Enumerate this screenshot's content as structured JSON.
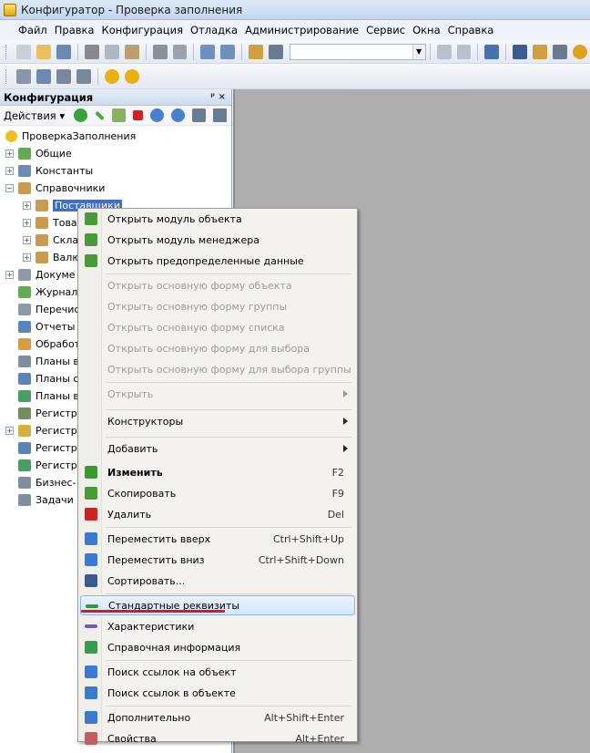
{
  "window": {
    "title": "Конфигуратор - Проверка заполнения"
  },
  "menubar": [
    "Файл",
    "Правка",
    "Конфигурация",
    "Отладка",
    "Администрирование",
    "Сервис",
    "Окна",
    "Справка"
  ],
  "panel": {
    "title": "Конфигурация",
    "actions_label": "Действия",
    "pin": "ᵖ ×",
    "tree": [
      {
        "label": "ПроверкаЗаполнения",
        "level": 0,
        "expander": "",
        "icon": "config-root-icon",
        "color": "#f0c020"
      },
      {
        "label": "Общие",
        "level": 1,
        "expander": "+",
        "icon": "common-icon",
        "color": "#4a9a3a"
      },
      {
        "label": "Константы",
        "level": 1,
        "expander": "+",
        "icon": "constants-icon",
        "color": "#5577aa"
      },
      {
        "label": "Справочники",
        "level": 1,
        "expander": "−",
        "icon": "catalogs-icon",
        "color": "#c08a30"
      },
      {
        "label": "Поставщики",
        "level": 2,
        "expander": "+",
        "icon": "catalog-icon",
        "color": "#c08a30",
        "selected": true
      },
      {
        "label": "Това",
        "level": 2,
        "expander": "+",
        "icon": "catalog-icon",
        "color": "#c08a30"
      },
      {
        "label": "Скла",
        "level": 2,
        "expander": "+",
        "icon": "catalog-icon",
        "color": "#c08a30"
      },
      {
        "label": "Валю",
        "level": 2,
        "expander": "+",
        "icon": "catalog-icon",
        "color": "#c08a30"
      },
      {
        "label": "Докуме",
        "level": 1,
        "expander": "+",
        "icon": "documents-icon",
        "color": "#7a8899"
      },
      {
        "label": "Журнал",
        "level": 1,
        "expander": "",
        "icon": "journals-icon",
        "color": "#4a9a3a"
      },
      {
        "label": "Перечис",
        "level": 1,
        "expander": "",
        "icon": "enums-icon",
        "color": "#7a8899"
      },
      {
        "label": "Отчеты",
        "level": 1,
        "expander": "",
        "icon": "reports-icon",
        "color": "#3a6fb0"
      },
      {
        "label": "Обработ",
        "level": 1,
        "expander": "",
        "icon": "dataprocessors-icon",
        "color": "#d08a20"
      },
      {
        "label": "Планы в",
        "level": 1,
        "expander": "",
        "icon": "chart-of-characteristics-icon",
        "color": "#6a7a90"
      },
      {
        "label": "Планы с",
        "level": 1,
        "expander": "",
        "icon": "chart-of-accounts-icon",
        "color": "#3a6fb0"
      },
      {
        "label": "Планы в",
        "level": 1,
        "expander": "",
        "icon": "chart-of-calc-icon",
        "color": "#2e8a4a"
      },
      {
        "label": "Регистр",
        "level": 1,
        "expander": "",
        "icon": "info-registers-icon",
        "color": "#5a7a40"
      },
      {
        "label": "Регистр",
        "level": 1,
        "expander": "+",
        "icon": "accum-registers-icon",
        "color": "#d0a020"
      },
      {
        "label": "Регистр",
        "level": 1,
        "expander": "",
        "icon": "accounting-registers-icon",
        "color": "#3a6fb0"
      },
      {
        "label": "Регистр",
        "level": 1,
        "expander": "",
        "icon": "calc-registers-icon",
        "color": "#2e8a4a"
      },
      {
        "label": "Бизнес-",
        "level": 1,
        "expander": "",
        "icon": "business-processes-icon",
        "color": "#6a7a90"
      },
      {
        "label": "Задачи",
        "level": 1,
        "expander": "",
        "icon": "tasks-icon",
        "color": "#6a7a90"
      }
    ]
  },
  "context_menu": [
    {
      "label": "Открыть модуль объекта",
      "icon": "module-object-icon",
      "color": "#4a9a3a"
    },
    {
      "label": "Открыть модуль менеджера",
      "icon": "module-manager-icon",
      "color": "#4a9a3a"
    },
    {
      "label": "Открыть предопределенные данные",
      "icon": "predefined-data-icon",
      "color": "#4a9a3a"
    },
    {
      "sep": true
    },
    {
      "label": "Открыть основную форму объекта",
      "disabled": true
    },
    {
      "label": "Открыть основную форму группы",
      "disabled": true
    },
    {
      "label": "Открыть основную форму списка",
      "disabled": true
    },
    {
      "label": "Открыть основную форму для выбора",
      "disabled": true
    },
    {
      "label": "Открыть основную форму для выбора группы",
      "disabled": true
    },
    {
      "sep": true
    },
    {
      "label": "Открыть",
      "disabled": true,
      "submenu": true
    },
    {
      "sep": true
    },
    {
      "label": "Конструкторы",
      "submenu": true
    },
    {
      "sep": true
    },
    {
      "label": "Добавить",
      "submenu": true
    },
    {
      "label": "Изменить",
      "bold": true,
      "shortcut": "F2",
      "icon": "edit-pencil-icon",
      "color": "#3a9a30"
    },
    {
      "label": "Скопировать",
      "shortcut": "F9",
      "icon": "copy-icon",
      "color": "#4a9a3a"
    },
    {
      "label": "Удалить",
      "shortcut": "Del",
      "icon": "delete-x-icon",
      "color": "#d02020"
    },
    {
      "sep": true
    },
    {
      "label": "Переместить вверх",
      "shortcut": "Ctrl+Shift+Up",
      "icon": "arrow-up-icon",
      "color": "#3a7ad0"
    },
    {
      "label": "Переместить вниз",
      "shortcut": "Ctrl+Shift+Down",
      "icon": "arrow-down-icon",
      "color": "#3a7ad0"
    },
    {
      "label": "Сортировать...",
      "icon": "sort-icon",
      "color": "#3a5a90"
    },
    {
      "sep": true
    },
    {
      "label": "Стандартные реквизиты",
      "icon": "standard-attributes-icon",
      "color": "#2e9a3a",
      "highlighted": true
    },
    {
      "label": "Характеристики",
      "icon": "characteristics-icon",
      "color": "#7a5ab0"
    },
    {
      "label": "Справочная информация",
      "icon": "help-info-icon",
      "color": "#3a9a50"
    },
    {
      "sep": true
    },
    {
      "label": "Поиск ссылок на объект",
      "icon": "find-refs-to-icon",
      "color": "#3a7ad0"
    },
    {
      "label": "Поиск ссылок в объекте",
      "icon": "find-refs-in-icon",
      "color": "#3a7ad0"
    },
    {
      "sep": true
    },
    {
      "label": "Дополнительно",
      "shortcut": "Alt+Shift+Enter",
      "icon": "advanced-icon",
      "color": "#3a7ad0"
    },
    {
      "label": "Свойства",
      "shortcut": "Alt+Enter",
      "icon": "properties-icon",
      "color": "#c06060"
    }
  ],
  "toolbar_icons": [
    "new-file-icon",
    "open-icon",
    "save-icon",
    "cut-icon",
    "copy-icon",
    "paste-icon",
    "print-icon",
    "preview-icon",
    "undo-icon",
    "redo-icon",
    "find-in-tree-icon",
    "search-icon"
  ],
  "toolbar_icons_right": [
    "go-back-icon",
    "go-forward-icon",
    "windows-icon",
    "syntax-assistant-icon",
    "help-search-icon",
    "help-icon",
    "info-icon"
  ],
  "toolbar2_icons": [
    "open-config-icon",
    "update-db-icon",
    "db-config-icon",
    "compare-icon",
    "run-debug-icon",
    "run-enterprise-icon"
  ]
}
